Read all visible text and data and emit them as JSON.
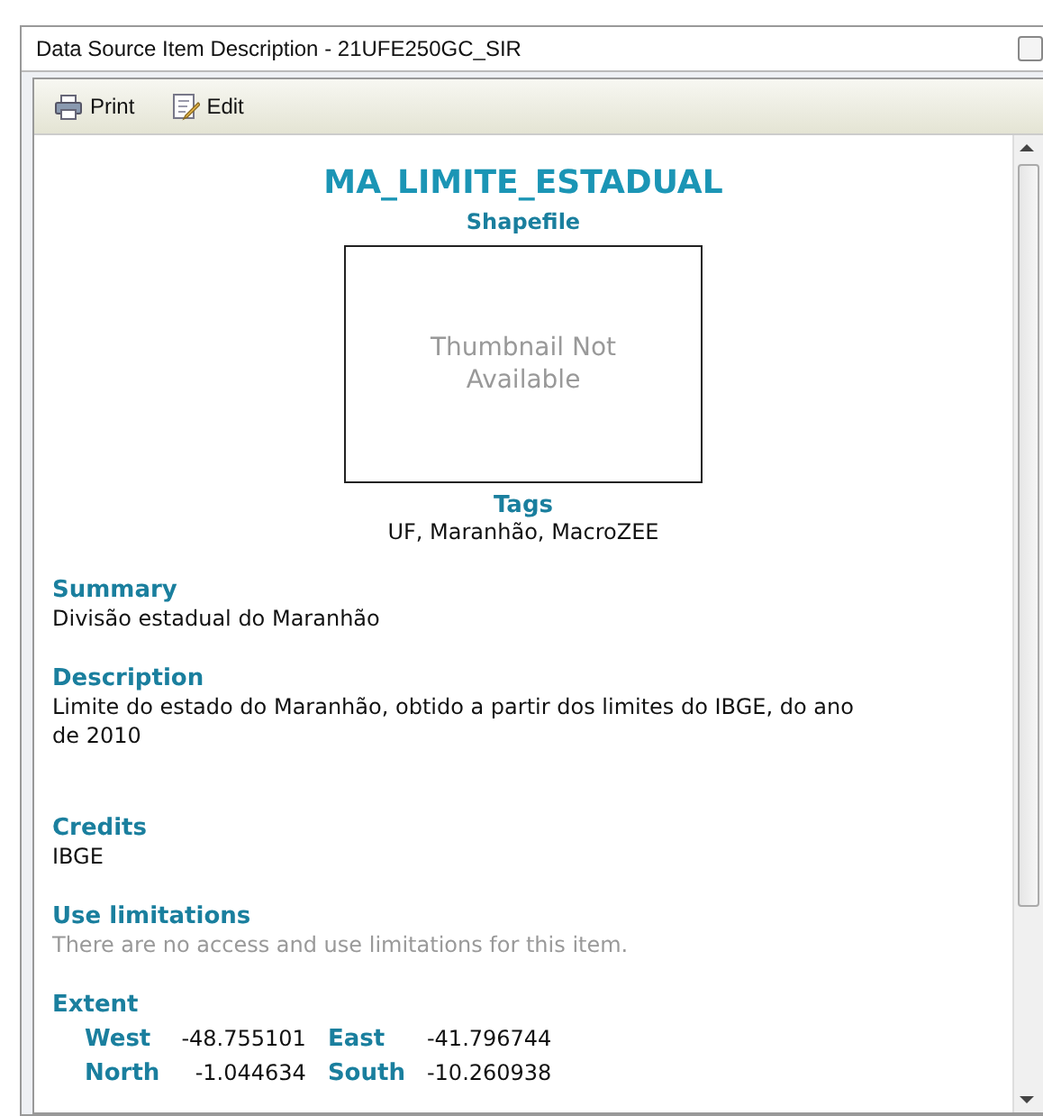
{
  "window": {
    "title": "Data Source Item Description - 21UFE250GC_SIR"
  },
  "toolbar": [
    {
      "label": "Print",
      "kind": "print"
    },
    {
      "label": "Edit",
      "kind": "edit"
    }
  ],
  "item": {
    "name": "MA_LIMITE_ESTADUAL",
    "type": "Shapefile",
    "thumbnail": "Thumbnail Not Available",
    "tags_heading": "Tags",
    "tags": "UF, Maranhão, MacroZEE"
  },
  "sections": [
    {
      "heading": "Summary",
      "text": "Divisão estadual do Maranhão",
      "muted": false
    },
    {
      "heading": "Description",
      "text": "Limite do estado do Maranhão, obtido a partir dos limites do IBGE, do ano de 2010",
      "muted": false
    },
    {
      "heading": "Credits",
      "text": "IBGE",
      "muted": false
    },
    {
      "heading": "Use limitations",
      "text": "There are no access and use limitations for this item.",
      "muted": true
    }
  ],
  "extent": {
    "heading": "Extent",
    "rows": [
      [
        {
          "label": "West",
          "value": "-48.755101"
        },
        {
          "label": "East",
          "value": "-41.796744"
        }
      ],
      [
        {
          "label": "North",
          "value": "-1.044634"
        },
        {
          "label": "South",
          "value": "-10.260938"
        }
      ]
    ]
  }
}
